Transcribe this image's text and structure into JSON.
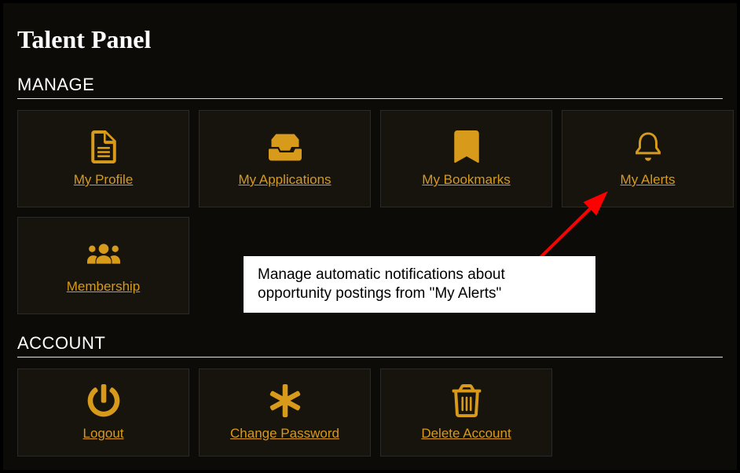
{
  "title": "Talent Panel",
  "sections": {
    "manage": {
      "heading": "MANAGE",
      "tiles": [
        {
          "id": "my-profile",
          "label": "My Profile",
          "icon": "file-icon"
        },
        {
          "id": "my-applications",
          "label": "My Applications",
          "icon": "inbox-icon"
        },
        {
          "id": "my-bookmarks",
          "label": "My Bookmarks",
          "icon": "bookmark-icon"
        },
        {
          "id": "my-alerts",
          "label": "My Alerts",
          "icon": "bell-icon"
        },
        {
          "id": "membership",
          "label": "Membership",
          "icon": "users-icon"
        }
      ]
    },
    "account": {
      "heading": "ACCOUNT",
      "tiles": [
        {
          "id": "logout",
          "label": "Logout",
          "icon": "power-icon"
        },
        {
          "id": "change-password",
          "label": "Change Password",
          "icon": "asterisk-icon"
        },
        {
          "id": "delete-account",
          "label": "Delete Account",
          "icon": "trash-icon"
        }
      ]
    }
  },
  "annotation": {
    "text": "Manage automatic notifications about opportunity postings from \"My Alerts\""
  },
  "colors": {
    "accent": "#d79a1a",
    "panel": "#0d0b07",
    "tile": "#17130d",
    "annotationArrow": "#ff0000"
  }
}
